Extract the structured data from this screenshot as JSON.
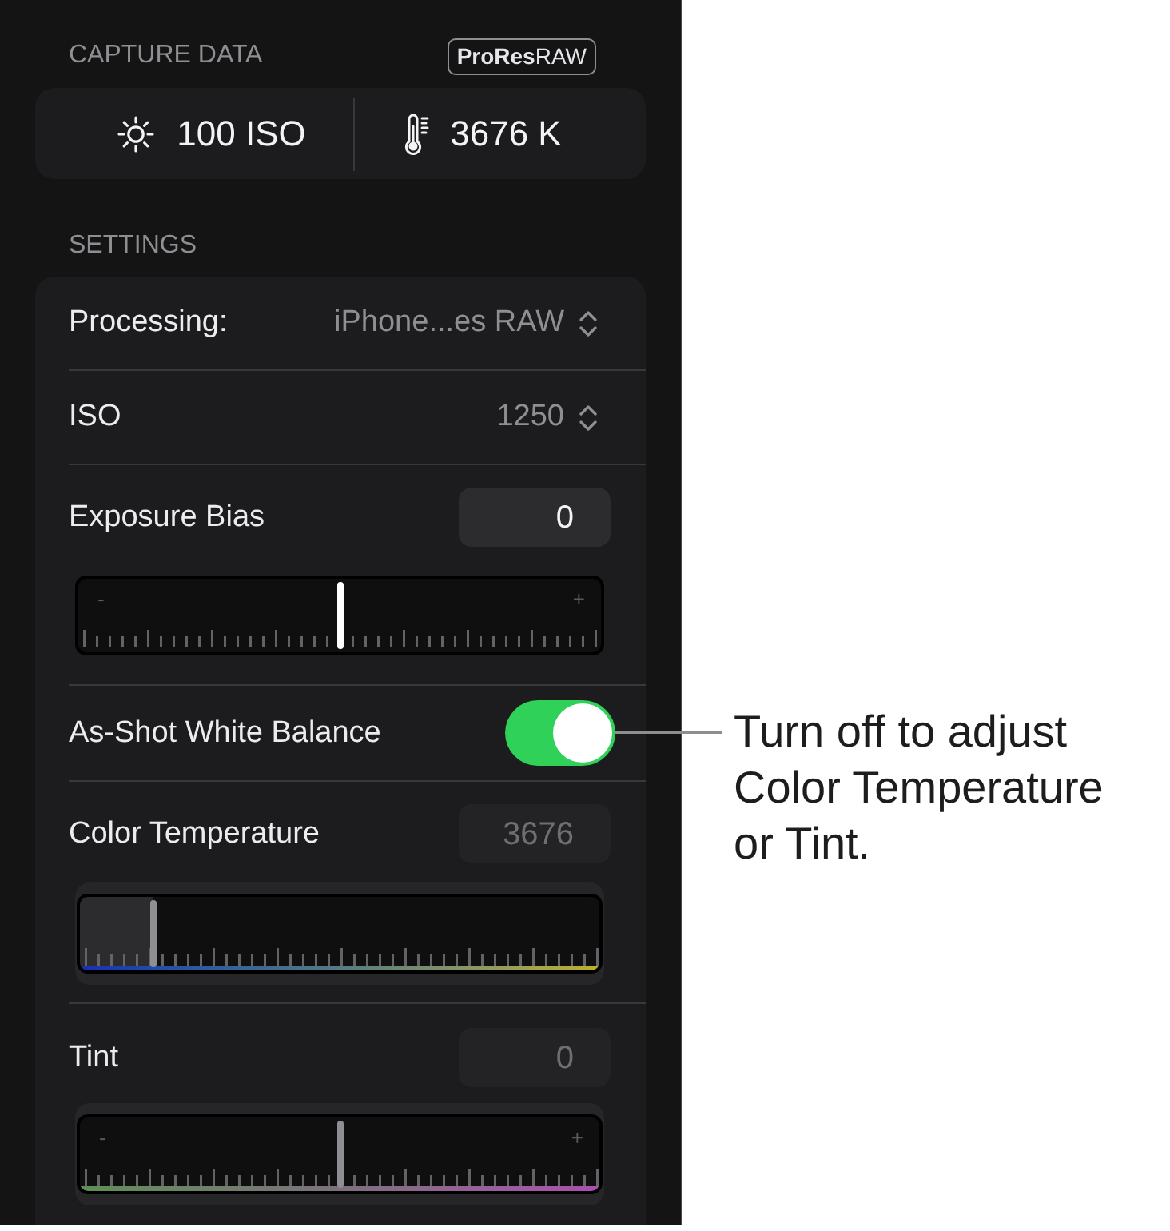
{
  "capture_data": {
    "heading": "CAPTURE DATA",
    "badge": "**ProRes**RAW",
    "readings": [
      {
        "kind": "iso",
        "text": "100 ISO"
      },
      {
        "kind": "temperature",
        "text": "3676 K"
      }
    ]
  },
  "settings": {
    "heading": "SETTINGS",
    "rows": [
      {
        "kind": "picker",
        "label": "Processing:",
        "value": "iPhone...es RAW"
      },
      {
        "kind": "picker",
        "label": "ISO",
        "value": "1250"
      },
      {
        "kind": "slider",
        "label": "Exposure Bias",
        "value": "0",
        "disabled": false,
        "min_label": "-",
        "max_label": "+",
        "level": 0.5
      },
      {
        "kind": "toggle",
        "label": "As-Shot White Balance",
        "on": true
      },
      {
        "kind": "temperature_slider",
        "label": "Color Temperature",
        "value": "3676",
        "disabled": true,
        "level": 0.14
      },
      {
        "kind": "tint_slider",
        "label": "Tint",
        "value": "0",
        "disabled": true,
        "min_label": "-",
        "max_label": "+",
        "level": 0.5
      }
    ]
  },
  "callout": {
    "text": "Turn off to adjust Color Temperature or Tint."
  }
}
